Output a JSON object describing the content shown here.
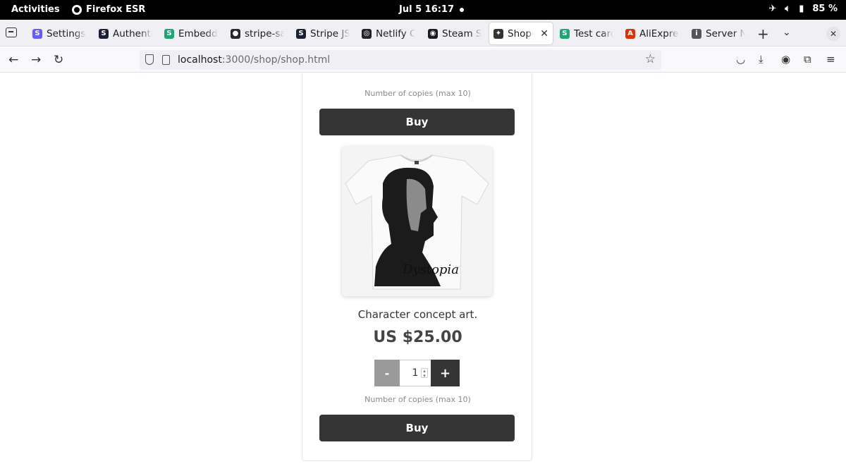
{
  "system": {
    "activities": "Activities",
    "app_name": "Firefox ESR",
    "clock": "Jul 5  16:17",
    "battery": "85 %"
  },
  "tabs": [
    {
      "label": "Settings –",
      "icon": "stripe-favicon",
      "color": "#635bff",
      "glyph": "S"
    },
    {
      "label": "Authentic",
      "icon": "stripe-favicon",
      "color": "#1a1f36",
      "glyph": "S"
    },
    {
      "label": "Embedde",
      "icon": "stripe-docs-favicon",
      "color": "#1ea672",
      "glyph": "S"
    },
    {
      "label": "stripe-sa",
      "icon": "github-icon",
      "color": "#24292f",
      "glyph": "●"
    },
    {
      "label": "Stripe JS",
      "icon": "stripe-favicon",
      "color": "#1a1f36",
      "glyph": "S"
    },
    {
      "label": "Netlify CL",
      "icon": "netlify-icon",
      "color": "#222",
      "glyph": "◎"
    },
    {
      "label": "Steam Su",
      "icon": "steam-icon",
      "color": "#171a21",
      "glyph": "◉"
    },
    {
      "label": "Shop++",
      "icon": "shop-favicon",
      "color": "#333",
      "glyph": "✦",
      "active": true
    },
    {
      "label": "Test card",
      "icon": "stripe-docs-favicon",
      "color": "#1ea672",
      "glyph": "S"
    },
    {
      "label": "AliExpres",
      "icon": "aliexpress-icon",
      "color": "#e62e04",
      "glyph": "A"
    },
    {
      "label": "Server No",
      "icon": "info-icon",
      "color": "#555",
      "glyph": "i"
    }
  ],
  "navbar": {
    "url_host": "localhost",
    "url_rest": ":3000/shop/shop.html"
  },
  "product_prev": {
    "quantity": "",
    "hint": "Number of copies (max 10)",
    "buy_label": "Buy"
  },
  "product": {
    "image_alt": "T-shirt with character portrait print",
    "print_text": "Dystopia",
    "description": "Character concept art.",
    "price": "US $25.00",
    "minus_label": "-",
    "quantity": "1",
    "plus_label": "+",
    "hint": "Number of copies (max 10)",
    "buy_label": "Buy"
  }
}
